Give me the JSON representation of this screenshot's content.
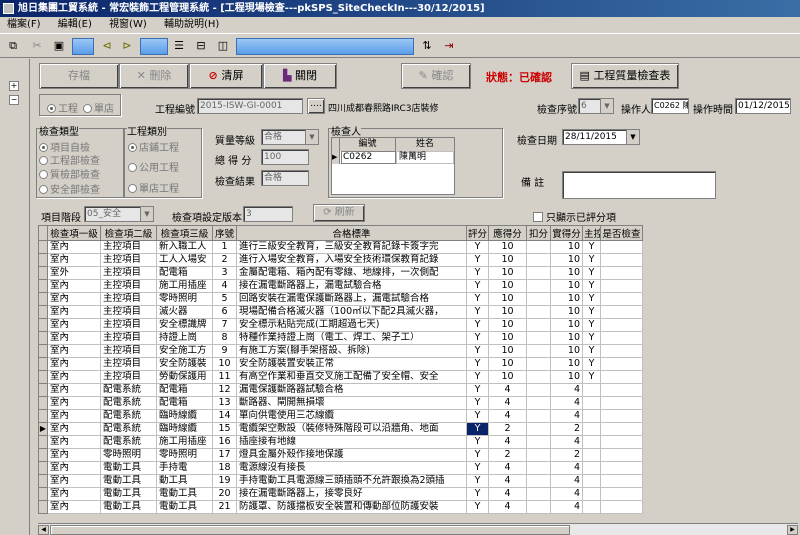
{
  "window": {
    "title": "旭日集團工貿系統 - 常宏裝飾工程管理系統 - [工程現場檢查---pkSPS_SiteCheckIn---30/12/2015]"
  },
  "menu": [
    "檔案(F)",
    "編輯(E)",
    "視窗(W)",
    "輔助說明(H)"
  ],
  "actions": {
    "save": "存檔",
    "delete": "刪除",
    "clear": "清屏",
    "close": "關閉",
    "confirm": "確認",
    "status": "狀態：已確認",
    "report": "工程質量檢查表"
  },
  "form": {
    "radio_project": "工程",
    "radio_store": "單店",
    "project_no_label": "工程編號",
    "project_no": "2015-ISW-GI-0001",
    "more_btn": "....",
    "project_name": "四川成都春熙路IRC3店裝修",
    "check_seq_label": "檢查序號",
    "check_seq": "6",
    "operator_label": "操作人",
    "operator": "C0262 陳",
    "op_time_label": "操作時間",
    "op_time": "01/12/2015",
    "check_type_label": "檢查類型",
    "check_types": [
      "項目自檢",
      "工程部檢查",
      "質檢部檢查",
      "安全部檢查"
    ],
    "proj_cat_label": "工程類別",
    "proj_cats": [
      "店鋪工程",
      "公用工程",
      "單店工程"
    ],
    "quality_label": "質量等級",
    "quality": "合格",
    "score_label": "總 得 分",
    "score": "100",
    "result_label": "檢查結果",
    "result": "合格",
    "inspector_label": "檢查人",
    "inspector_cols": [
      "編號",
      "姓名"
    ],
    "inspector_id": "C0262",
    "inspector_name": "陳萬明",
    "check_date_label": "檢查日期",
    "check_date": "28/11/2015",
    "remark_label": "備 註",
    "stage_label": "項目階段",
    "stage": "05_安全",
    "version_label": "檢查項設定版本",
    "version": "3",
    "refresh": "刷新",
    "only_scored": "只顯示已評分項"
  },
  "grid": {
    "headers": [
      "檢查項一級",
      "檢查項二級",
      "檢查項三級",
      "序號",
      "合格標準",
      "評分",
      "應得分",
      "扣分",
      "實得分",
      "主控",
      "是否檢查"
    ],
    "rows": [
      [
        "室內",
        "主控項目",
        "新入職工人",
        "1",
        "進行三級安全教育，三級安全教育記錄卡簽字完",
        "Y",
        "10",
        "",
        "10",
        "Y",
        ""
      ],
      [
        "室內",
        "主控項目",
        "工人入場安",
        "2",
        "進行入場安全教育，入場安全技術環保教育記錄",
        "Y",
        "10",
        "",
        "10",
        "Y",
        ""
      ],
      [
        "室外",
        "主控項目",
        "配電箱",
        "3",
        "金屬配電箱、箱內配有零線、地線排，一次側配",
        "Y",
        "10",
        "",
        "10",
        "Y",
        ""
      ],
      [
        "室內",
        "主控項目",
        "施工用插座",
        "4",
        "接在漏電斷路器上，漏電試驗合格",
        "Y",
        "10",
        "",
        "10",
        "Y",
        ""
      ],
      [
        "室內",
        "主控項目",
        "零時照明",
        "5",
        "回路安裝在漏電保護斷路器上，漏電試驗合格",
        "Y",
        "10",
        "",
        "10",
        "Y",
        ""
      ],
      [
        "室內",
        "主控項目",
        "滅火器",
        "6",
        "現場配備合格滅火器（100㎡以下配2具滅火器，",
        "Y",
        "10",
        "",
        "10",
        "Y",
        ""
      ],
      [
        "室內",
        "主控項目",
        "安全標識牌",
        "7",
        "安全標示粘貼完成(工期超過七天)",
        "Y",
        "10",
        "",
        "10",
        "Y",
        ""
      ],
      [
        "室內",
        "主控項目",
        "持證上崗",
        "8",
        "特種作業持證上崗（電工、焊工、架子工）",
        "Y",
        "10",
        "",
        "10",
        "Y",
        ""
      ],
      [
        "室內",
        "主控項目",
        "安全施工方",
        "9",
        "有施工方案(腳手架搭設、拆除)",
        "Y",
        "10",
        "",
        "10",
        "Y",
        ""
      ],
      [
        "室內",
        "主控項目",
        "安全防護裝",
        "10",
        "安全防護裝置安裝正常",
        "Y",
        "10",
        "",
        "10",
        "Y",
        ""
      ],
      [
        "室內",
        "主控項目",
        "勞動保護用",
        "11",
        "有高空作業和垂直交叉施工配備了安全帽、安全",
        "Y",
        "10",
        "",
        "10",
        "Y",
        ""
      ],
      [
        "室內",
        "配電系統",
        "配電箱",
        "12",
        "漏電保護斷路器試驗合格",
        "Y",
        "4",
        "",
        "4",
        "",
        ""
      ],
      [
        "室內",
        "配電系統",
        "配電箱",
        "13",
        "斷路器、閘開無損壞",
        "Y",
        "4",
        "",
        "4",
        "",
        ""
      ],
      [
        "室內",
        "配電系統",
        "臨時線纜",
        "14",
        "單向供電使用三芯線纜",
        "Y",
        "4",
        "",
        "4",
        "",
        ""
      ],
      [
        "室內",
        "配電系統",
        "臨時線纜",
        "15",
        "電纜架空敷設（裝修特殊階段可以沿牆角、地面",
        "Y",
        "2",
        "",
        "2",
        "",
        ""
      ],
      [
        "室內",
        "配電系統",
        "施工用插座",
        "16",
        "插座接有地線",
        "Y",
        "4",
        "",
        "4",
        "",
        ""
      ],
      [
        "室內",
        "零時照明",
        "零時照明",
        "17",
        "燈具金屬外殼作接地保護",
        "Y",
        "2",
        "",
        "2",
        "",
        ""
      ],
      [
        "室內",
        "電動工具",
        "手持電",
        "18",
        "電源線沒有接長",
        "Y",
        "4",
        "",
        "4",
        "",
        ""
      ],
      [
        "室內",
        "電動工具",
        "動工具",
        "19",
        "手持電動工具電源線三頭插頭不允許跟換為2頭插",
        "Y",
        "4",
        "",
        "4",
        "",
        ""
      ],
      [
        "室內",
        "電動工具",
        "電動工具",
        "20",
        "接在漏電斷路器上，接零良好",
        "Y",
        "4",
        "",
        "4",
        "",
        ""
      ],
      [
        "室內",
        "電動工具",
        "電動工具",
        "21",
        "防護罩、防護擋板安全裝置和傳動部位防護安裝",
        "Y",
        "4",
        "",
        "4",
        "",
        ""
      ]
    ]
  }
}
